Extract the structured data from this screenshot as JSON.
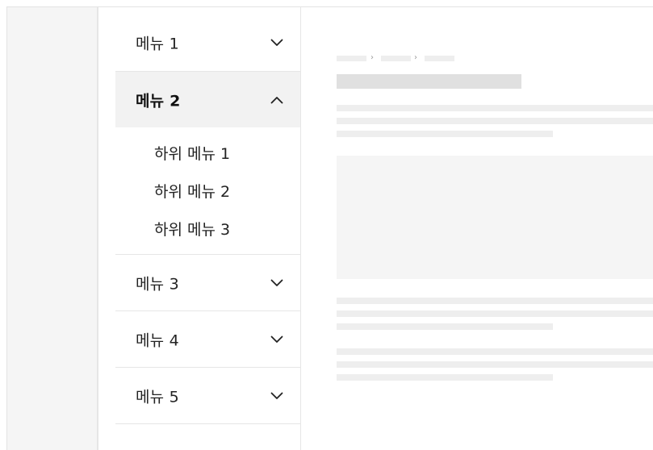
{
  "sidebar": {
    "items": [
      {
        "label": "메뉴 1",
        "chevron": "chevron-down-icon",
        "expanded": false
      },
      {
        "label": "메뉴 2",
        "chevron": "chevron-up-icon",
        "expanded": true,
        "children": [
          {
            "label": "하위 메뉴 1"
          },
          {
            "label": "하위 메뉴 2"
          },
          {
            "label": "하위 메뉴 3"
          }
        ]
      },
      {
        "label": "메뉴 3",
        "chevron": "chevron-down-icon",
        "expanded": false
      },
      {
        "label": "메뉴 4",
        "chevron": "chevron-down-icon",
        "expanded": false
      },
      {
        "label": "메뉴 5",
        "chevron": "chevron-down-icon",
        "expanded": false
      }
    ],
    "active_background": "#f2f2f2"
  },
  "content": {
    "state": "loading-skeleton",
    "breadcrumb_separator": "›",
    "skeleton_color": "#eeeeee",
    "title_skeleton_color": "#e0e0e0",
    "media_skeleton_color": "#f5f5f5"
  }
}
